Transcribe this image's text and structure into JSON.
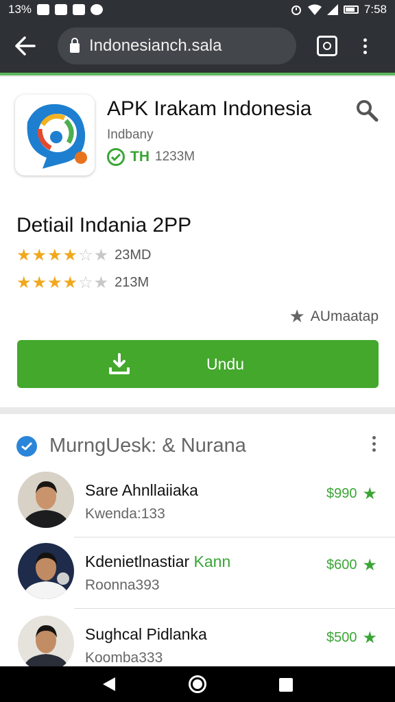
{
  "status_bar": {
    "left_text": "13%",
    "time": "7:58",
    "icons": [
      "mail-icon",
      "mail-icon",
      "photo-icon",
      "messenger-icon",
      "alarm-icon",
      "wifi-icon",
      "signal-icon",
      "battery-icon"
    ]
  },
  "browser": {
    "url": "Indonesianch.sala",
    "back_icon": "arrow-left-icon",
    "tabs_icon": "tabs-icon",
    "menu_icon": "more-vert-icon"
  },
  "app": {
    "title": "APK Irakam Indonesia",
    "developer": "Indbany",
    "badge": "TH",
    "size": "1233M",
    "icon": "chat-app-logo-icon"
  },
  "details": {
    "title": "Detiail Indania 2PP",
    "ratings": [
      {
        "stars": 4,
        "count": "23MD"
      },
      {
        "stars": 4,
        "count": "213M"
      }
    ],
    "alt_label": "AUmaatap",
    "download_label": "Undu"
  },
  "section": {
    "title": "MurngUesk: & Nurana"
  },
  "people": [
    {
      "name": "Sare Ahnllaiiaka",
      "name_highlight": "",
      "sub": "Kwenda:133",
      "price": "$990"
    },
    {
      "name": "Kdenietlnastiar ",
      "name_highlight": "Kann",
      "sub": "Roonna393",
      "price": "$600"
    },
    {
      "name": "Sughcal Pidlanka",
      "name_highlight": "",
      "sub": "Koomba333",
      "price": "$500"
    }
  ],
  "colors": {
    "topbar": "#2e3136",
    "accent_green": "#43a82c",
    "star_gold": "#f0a81c",
    "check_blue": "#2b86d9"
  }
}
